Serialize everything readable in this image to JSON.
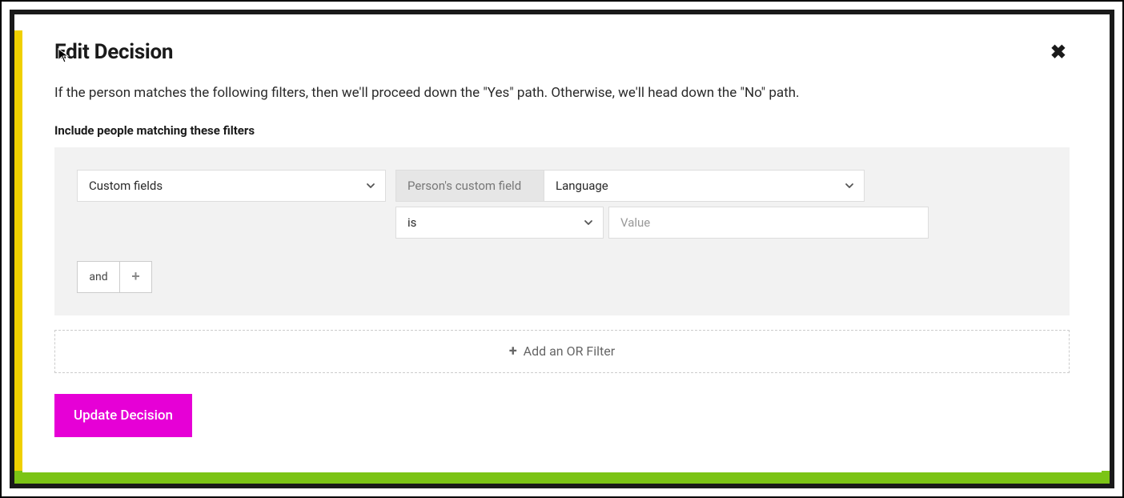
{
  "modal": {
    "title": "Edit Decision",
    "description": "If the person matches the following filters, then we'll proceed down the \"Yes\" path. Otherwise, we'll head down the \"No\" path.",
    "filter_heading": "Include people matching these filters"
  },
  "filter": {
    "category_select": "Custom fields",
    "field_label": "Person's custom field",
    "field_select": "Language",
    "operator_select": "is",
    "value_placeholder": "Value",
    "and_label": "and"
  },
  "or_filter": {
    "label": "Add an OR Filter"
  },
  "actions": {
    "update_button": "Update Decision"
  }
}
